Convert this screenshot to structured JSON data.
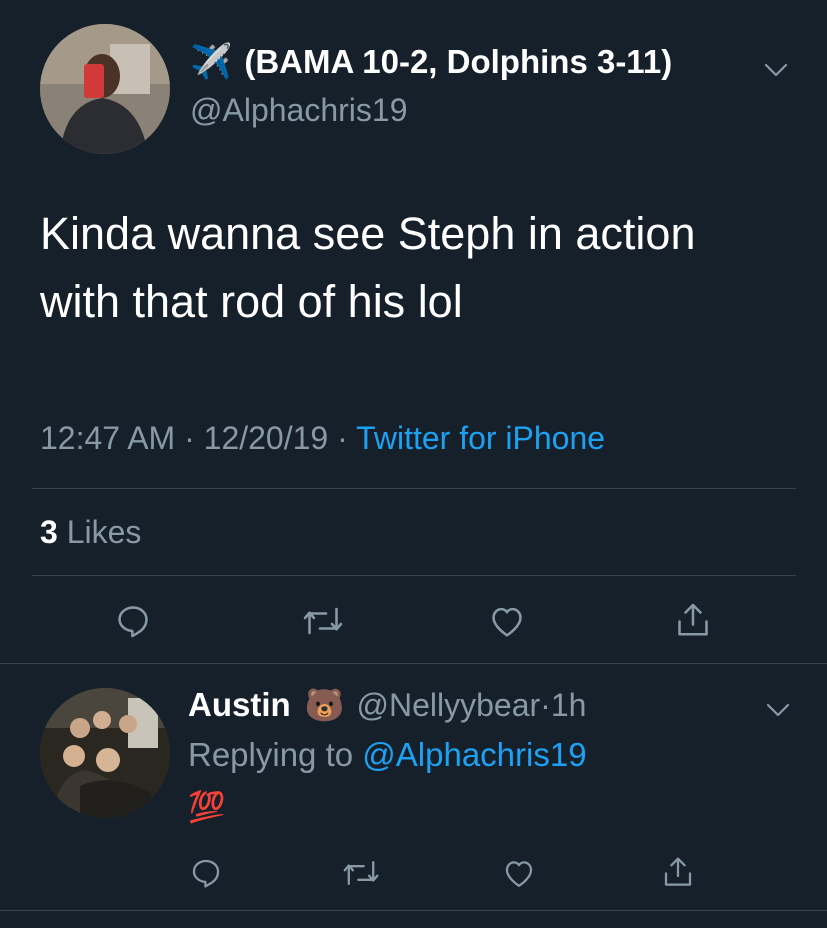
{
  "tweet": {
    "author_emoji": "✈️",
    "display_name": "(BAMA 10-2, Dolphins 3-11)",
    "handle": "@Alphachris19",
    "text_line1": "Kinda wanna see Steph in action",
    "text_line2": "with that rod of his lol",
    "time": "12:47 AM",
    "sep1": " · ",
    "date": "12/20/19",
    "sep2": " · ",
    "source": "Twitter for iPhone",
    "likes_count": "3",
    "likes_label": " Likes",
    "icons": [
      "reply-icon",
      "retweet-icon",
      "like-icon",
      "share-icon"
    ]
  },
  "reply": {
    "display_name": "Austin",
    "name_emoji": "🐻",
    "handle": "@Nellyybear",
    "dot": " · ",
    "age": "1h",
    "replying_label": "Replying to ",
    "replying_handle": "@Alphachris19",
    "text_emoji": "💯",
    "icons": [
      "reply-icon",
      "retweet-icon",
      "like-icon",
      "share-icon"
    ]
  },
  "colors": {
    "background": "#15202b",
    "secondary_text": "#8899a6",
    "link": "#1da1f2",
    "divider": "#38444d"
  }
}
